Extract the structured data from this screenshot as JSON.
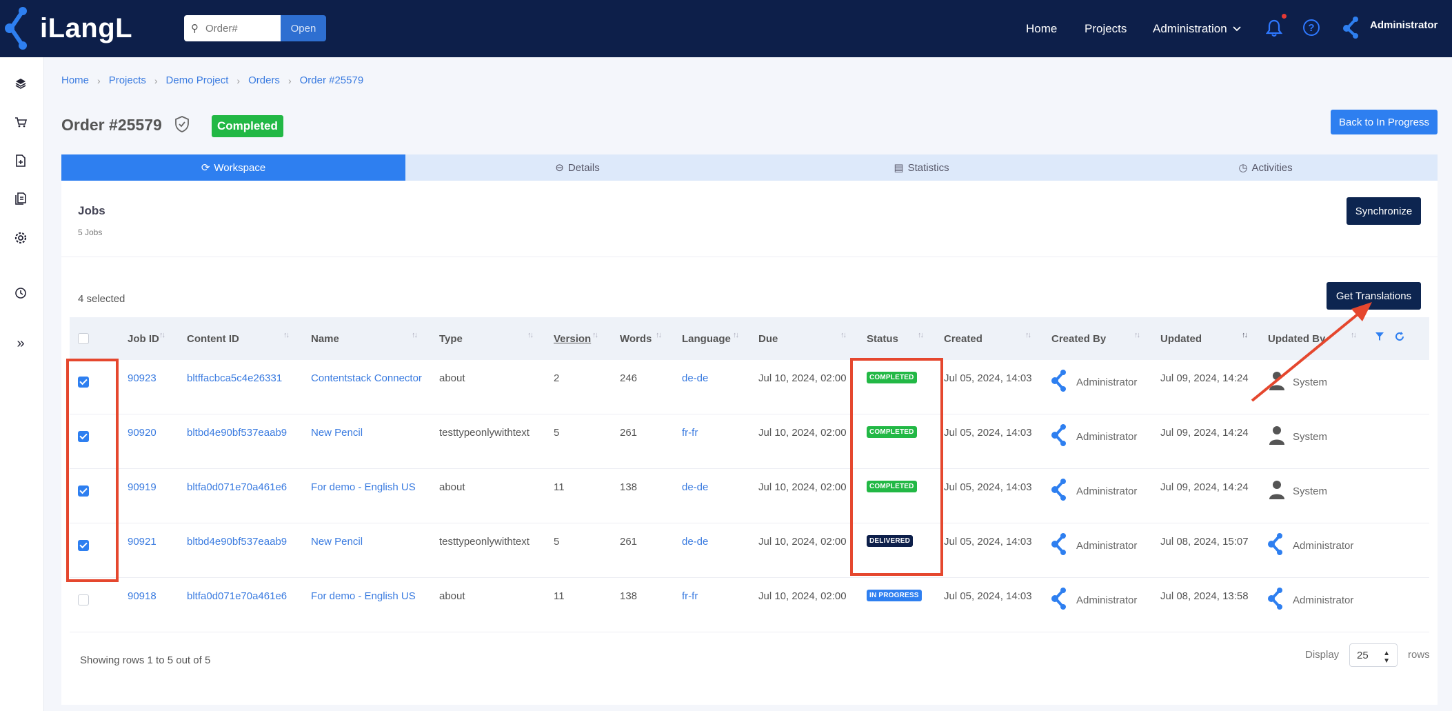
{
  "app": {
    "logo_text": "iLangL"
  },
  "topbar": {
    "search_placeholder": "Order#",
    "open_label": "Open",
    "nav": {
      "home": "Home",
      "projects": "Projects",
      "administration": "Administration"
    },
    "user": "Administrator"
  },
  "breadcrumb": [
    "Home",
    "Projects",
    "Demo Project",
    "Orders",
    "Order #25579"
  ],
  "header": {
    "title": "Order #25579",
    "status": "Completed",
    "back_button": "Back to In Progress"
  },
  "tabs": [
    "Workspace",
    "Details",
    "Statistics",
    "Activities"
  ],
  "jobs": {
    "title": "Jobs",
    "count": "5 Jobs",
    "sync_button": "Synchronize",
    "selected_text": "4 selected",
    "get_translations_button": "Get Translations",
    "columns": [
      "Job ID",
      "Content ID",
      "Name",
      "Type",
      "Version",
      "Words",
      "Language",
      "Due",
      "Status",
      "Created",
      "Created By",
      "Updated",
      "Updated By"
    ],
    "rows": [
      {
        "checked": true,
        "job_id": "90923",
        "content_id": "bltffacbca5c4e26331",
        "name": "Contentstack Connector",
        "type": "about",
        "version": "2",
        "words": "246",
        "language": "de-de",
        "due": "Jul 10, 2024, 02:00",
        "status": "COMPLETED",
        "created": "Jul 05, 2024, 14:03",
        "created_by": "Administrator",
        "updated": "Jul 09, 2024, 14:24",
        "updated_by": "System"
      },
      {
        "checked": true,
        "job_id": "90920",
        "content_id": "bltbd4e90bf537eaab9",
        "name": "New Pencil",
        "type": "testtypeonlywithtext",
        "version": "5",
        "words": "261",
        "language": "fr-fr",
        "due": "Jul 10, 2024, 02:00",
        "status": "COMPLETED",
        "created": "Jul 05, 2024, 14:03",
        "created_by": "Administrator",
        "updated": "Jul 09, 2024, 14:24",
        "updated_by": "System"
      },
      {
        "checked": true,
        "job_id": "90919",
        "content_id": "bltfa0d071e70a461e6",
        "name": "For demo - English US",
        "type": "about",
        "version": "11",
        "words": "138",
        "language": "de-de",
        "due": "Jul 10, 2024, 02:00",
        "status": "COMPLETED",
        "created": "Jul 05, 2024, 14:03",
        "created_by": "Administrator",
        "updated": "Jul 09, 2024, 14:24",
        "updated_by": "System"
      },
      {
        "checked": true,
        "job_id": "90921",
        "content_id": "bltbd4e90bf537eaab9",
        "name": "New Pencil",
        "type": "testtypeonlywithtext",
        "version": "5",
        "words": "261",
        "language": "de-de",
        "due": "Jul 10, 2024, 02:00",
        "status": "DELIVERED",
        "created": "Jul 05, 2024, 14:03",
        "created_by": "Administrator",
        "updated": "Jul 08, 2024, 15:07",
        "updated_by": "Administrator"
      },
      {
        "checked": false,
        "job_id": "90918",
        "content_id": "bltfa0d071e70a461e6",
        "name": "For demo - English US",
        "type": "about",
        "version": "11",
        "words": "138",
        "language": "fr-fr",
        "due": "Jul 10, 2024, 02:00",
        "status": "IN PROGRESS",
        "created": "Jul 05, 2024, 14:03",
        "created_by": "Administrator",
        "updated": "Jul 08, 2024, 13:58",
        "updated_by": "Administrator"
      }
    ],
    "footer_text": "Showing rows 1 to 5 out of 5",
    "display_label": "Display",
    "display_value": "25",
    "rows_label": "rows"
  },
  "colors": {
    "navy": "#0d1f4a",
    "accent": "#2e7ff0",
    "completed": "#22b845",
    "annotation": "#e5472e"
  }
}
